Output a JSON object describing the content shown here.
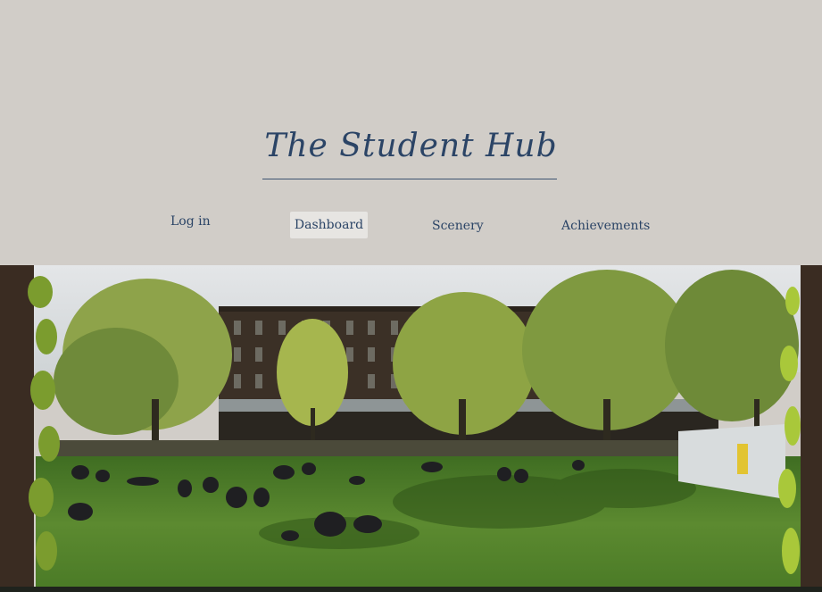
{
  "site": {
    "title": "The Student Hub"
  },
  "nav": {
    "items": [
      {
        "label": "Log in",
        "active": false
      },
      {
        "label": "Dashboard",
        "active": true
      },
      {
        "label": "Scenery",
        "active": false
      },
      {
        "label": "Achievements",
        "active": false
      }
    ]
  },
  "colors": {
    "background": "#d1cdc8",
    "title_text": "#2b4466",
    "active_tab": "#e7e5e2"
  },
  "hero": {
    "image": "campus-lawn-photo"
  }
}
